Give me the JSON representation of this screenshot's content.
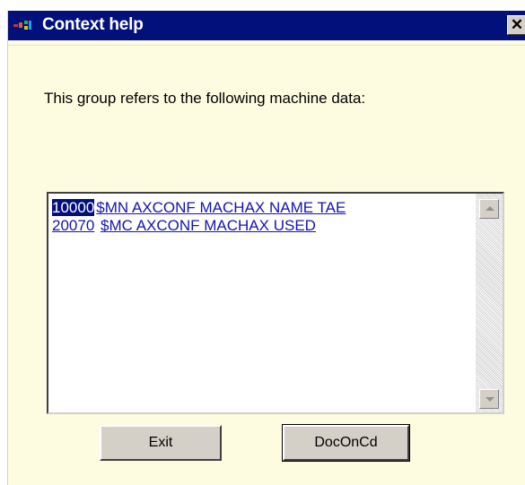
{
  "window": {
    "title": "Context help",
    "close_glyph": "✕"
  },
  "prompt": "This group refers to the following machine data:",
  "machine_data": [
    {
      "number": "10000",
      "name": "$MN_AXCONF_MACHAX_NAME_TAB",
      "displayed_name": "$MN  AXCONF  MACHAX  NAME  TAE",
      "selected": true
    },
    {
      "number": "20070",
      "name": "$MC_AXCONF_MACHAX_USED",
      "displayed_name": "$MC  AXCONF  MACHAX  USED",
      "selected": false
    }
  ],
  "buttons": {
    "exit": "Exit",
    "doc": "DocOnCd"
  },
  "colors": {
    "titlebar": "#02107c",
    "background": "#fdfbe0",
    "link": "#1414b0"
  },
  "icons": {
    "app": "app-icon",
    "close": "close-icon",
    "scroll_up": "scroll-up-arrow-icon",
    "scroll_down": "scroll-down-arrow-icon"
  }
}
